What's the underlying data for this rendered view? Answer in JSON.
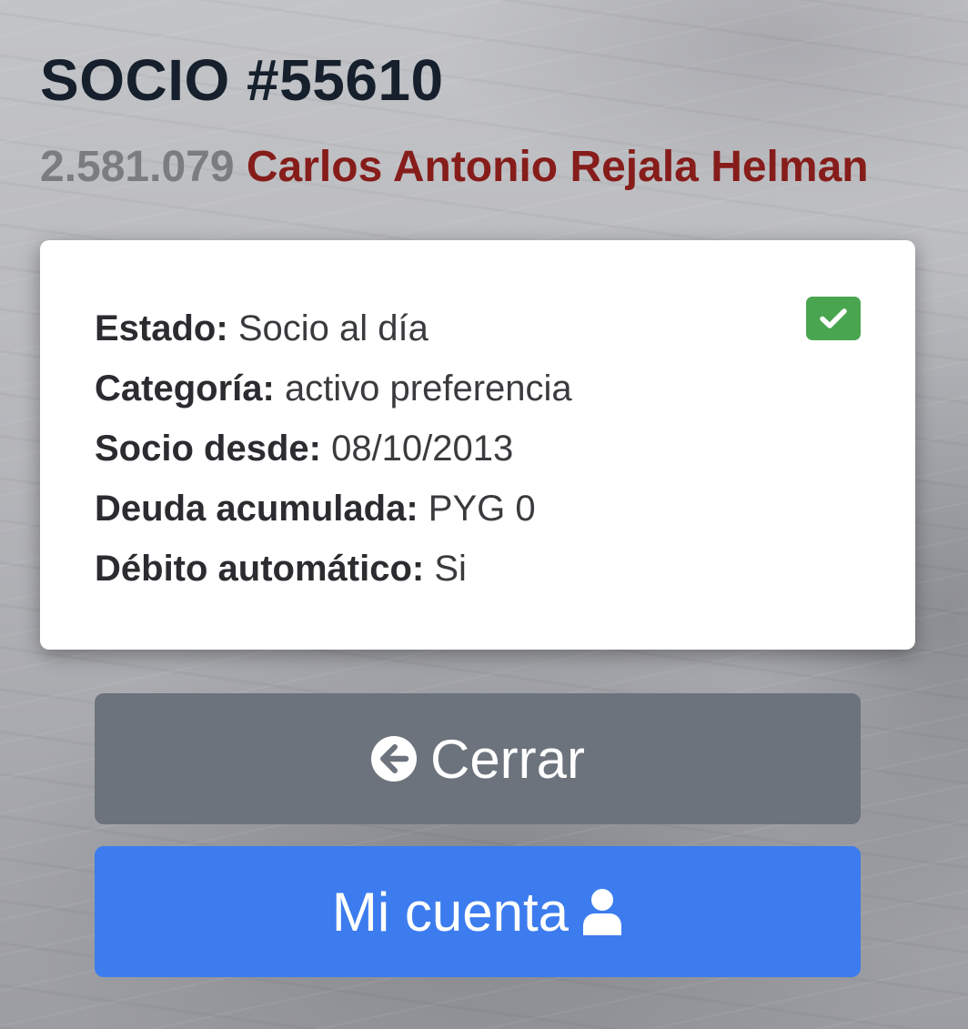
{
  "header": {
    "title": "SOCIO #55610",
    "document_number": "2.581.079",
    "member_name": "Carlos Antonio Rejala Helman"
  },
  "card": {
    "status_icon": "check-icon",
    "status_color": "#4aa551",
    "rows": [
      {
        "label": "Estado:",
        "value": "Socio al día"
      },
      {
        "label": "Categoría:",
        "value": "activo preferencia"
      },
      {
        "label": "Socio desde:",
        "value": "08/10/2013"
      },
      {
        "label": "Deuda acumulada:",
        "value": "PYG 0"
      },
      {
        "label": "Débito automático:",
        "value": "Si"
      }
    ]
  },
  "buttons": {
    "close_label": "Cerrar",
    "close_icon": "arrow-circle-left-icon",
    "close_color": "#6c737c",
    "account_label": "Mi cuenta",
    "account_icon": "user-icon",
    "account_color": "#3c7cee"
  }
}
